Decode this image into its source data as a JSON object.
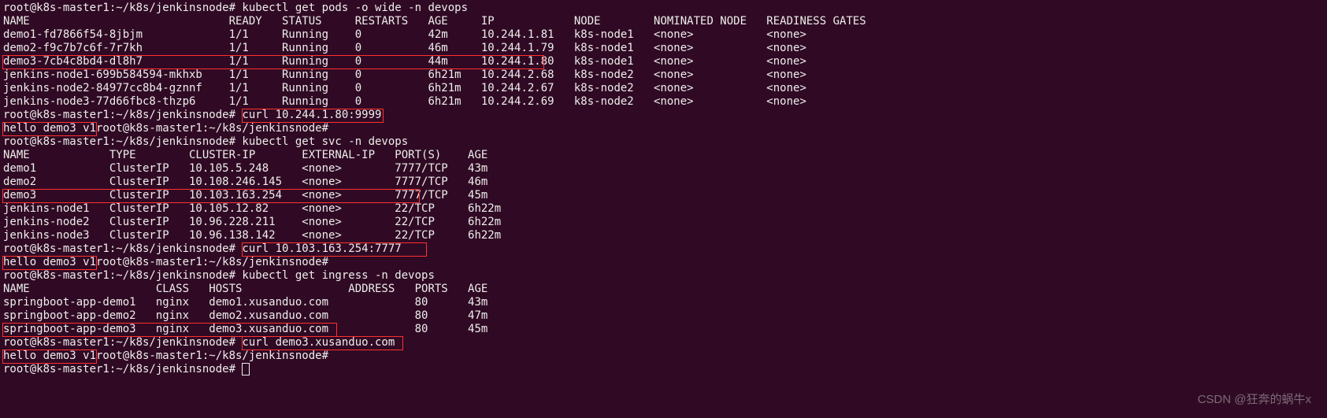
{
  "prompt": "root@k8s-master1:~/k8s/jenkinsnode#",
  "cmd_pods": "kubectl get pods -o wide -n devops",
  "pods_header": {
    "name": "NAME",
    "ready": "READY",
    "status": "STATUS",
    "restarts": "RESTARTS",
    "age": "AGE",
    "ip": "IP",
    "node": "NODE",
    "nominated": "NOMINATED NODE",
    "gates": "READINESS GATES"
  },
  "pods": [
    {
      "name": "demo1-fd7866f54-8jbjm",
      "ready": "1/1",
      "status": "Running",
      "restarts": "0",
      "age": "42m",
      "ip": "10.244.1.81",
      "node": "k8s-node1",
      "nominated": "<none>",
      "gates": "<none>"
    },
    {
      "name": "demo2-f9c7b7c6f-7r7kh",
      "ready": "1/1",
      "status": "Running",
      "restarts": "0",
      "age": "46m",
      "ip": "10.244.1.79",
      "node": "k8s-node1",
      "nominated": "<none>",
      "gates": "<none>"
    },
    {
      "name": "demo3-7cb4c8bd4-dl8h7",
      "ready": "1/1",
      "status": "Running",
      "restarts": "0",
      "age": "44m",
      "ip": "10.244.1.80",
      "node": "k8s-node1",
      "nominated": "<none>",
      "gates": "<none>"
    },
    {
      "name": "jenkins-node1-699b584594-mkhxb",
      "ready": "1/1",
      "status": "Running",
      "restarts": "0",
      "age": "6h21m",
      "ip": "10.244.2.68",
      "node": "k8s-node2",
      "nominated": "<none>",
      "gates": "<none>"
    },
    {
      "name": "jenkins-node2-84977cc8b4-gznnf",
      "ready": "1/1",
      "status": "Running",
      "restarts": "0",
      "age": "6h21m",
      "ip": "10.244.2.67",
      "node": "k8s-node2",
      "nominated": "<none>",
      "gates": "<none>"
    },
    {
      "name": "jenkins-node3-77d66fbc8-thzp6",
      "ready": "1/1",
      "status": "Running",
      "restarts": "0",
      "age": "6h21m",
      "ip": "10.244.2.69",
      "node": "k8s-node2",
      "nominated": "<none>",
      "gates": "<none>"
    }
  ],
  "cmd_curl1": "curl 10.244.1.80:9999",
  "hello": "hello demo3 v1",
  "cmd_svc": "kubectl get svc -n devops",
  "svc_header": {
    "name": "NAME",
    "type": "TYPE",
    "cip": "CLUSTER-IP",
    "eip": "EXTERNAL-IP",
    "ports": "PORT(S)",
    "age": "AGE"
  },
  "svcs": [
    {
      "name": "demo1",
      "type": "ClusterIP",
      "cip": "10.105.5.248",
      "eip": "<none>",
      "ports": "7777/TCP",
      "age": "43m"
    },
    {
      "name": "demo2",
      "type": "ClusterIP",
      "cip": "10.108.246.145",
      "eip": "<none>",
      "ports": "7777/TCP",
      "age": "46m"
    },
    {
      "name": "demo3",
      "type": "ClusterIP",
      "cip": "10.103.163.254",
      "eip": "<none>",
      "ports": "7777/TCP",
      "age": "45m"
    },
    {
      "name": "jenkins-node1",
      "type": "ClusterIP",
      "cip": "10.105.12.82",
      "eip": "<none>",
      "ports": "22/TCP",
      "age": "6h22m"
    },
    {
      "name": "jenkins-node2",
      "type": "ClusterIP",
      "cip": "10.96.228.211",
      "eip": "<none>",
      "ports": "22/TCP",
      "age": "6h22m"
    },
    {
      "name": "jenkins-node3",
      "type": "ClusterIP",
      "cip": "10.96.138.142",
      "eip": "<none>",
      "ports": "22/TCP",
      "age": "6h22m"
    }
  ],
  "cmd_curl2": "curl 10.103.163.254:7777",
  "cmd_ing": "kubectl get ingress -n devops",
  "ing_header": {
    "name": "NAME",
    "class": "CLASS",
    "hosts": "HOSTS",
    "address": "ADDRESS",
    "ports": "PORTS",
    "age": "AGE"
  },
  "ings": [
    {
      "name": "springboot-app-demo1",
      "class": "nginx",
      "hosts": "demo1.xusanduo.com",
      "address": "",
      "ports": "80",
      "age": "43m"
    },
    {
      "name": "springboot-app-demo2",
      "class": "nginx",
      "hosts": "demo2.xusanduo.com",
      "address": "",
      "ports": "80",
      "age": "47m"
    },
    {
      "name": "springboot-app-demo3",
      "class": "nginx",
      "hosts": "demo3.xusanduo.com",
      "address": "",
      "ports": "80",
      "age": "45m"
    }
  ],
  "cmd_curl3": "curl demo3.xusanduo.com",
  "watermark": "CSDN @狂奔的蜗牛x"
}
